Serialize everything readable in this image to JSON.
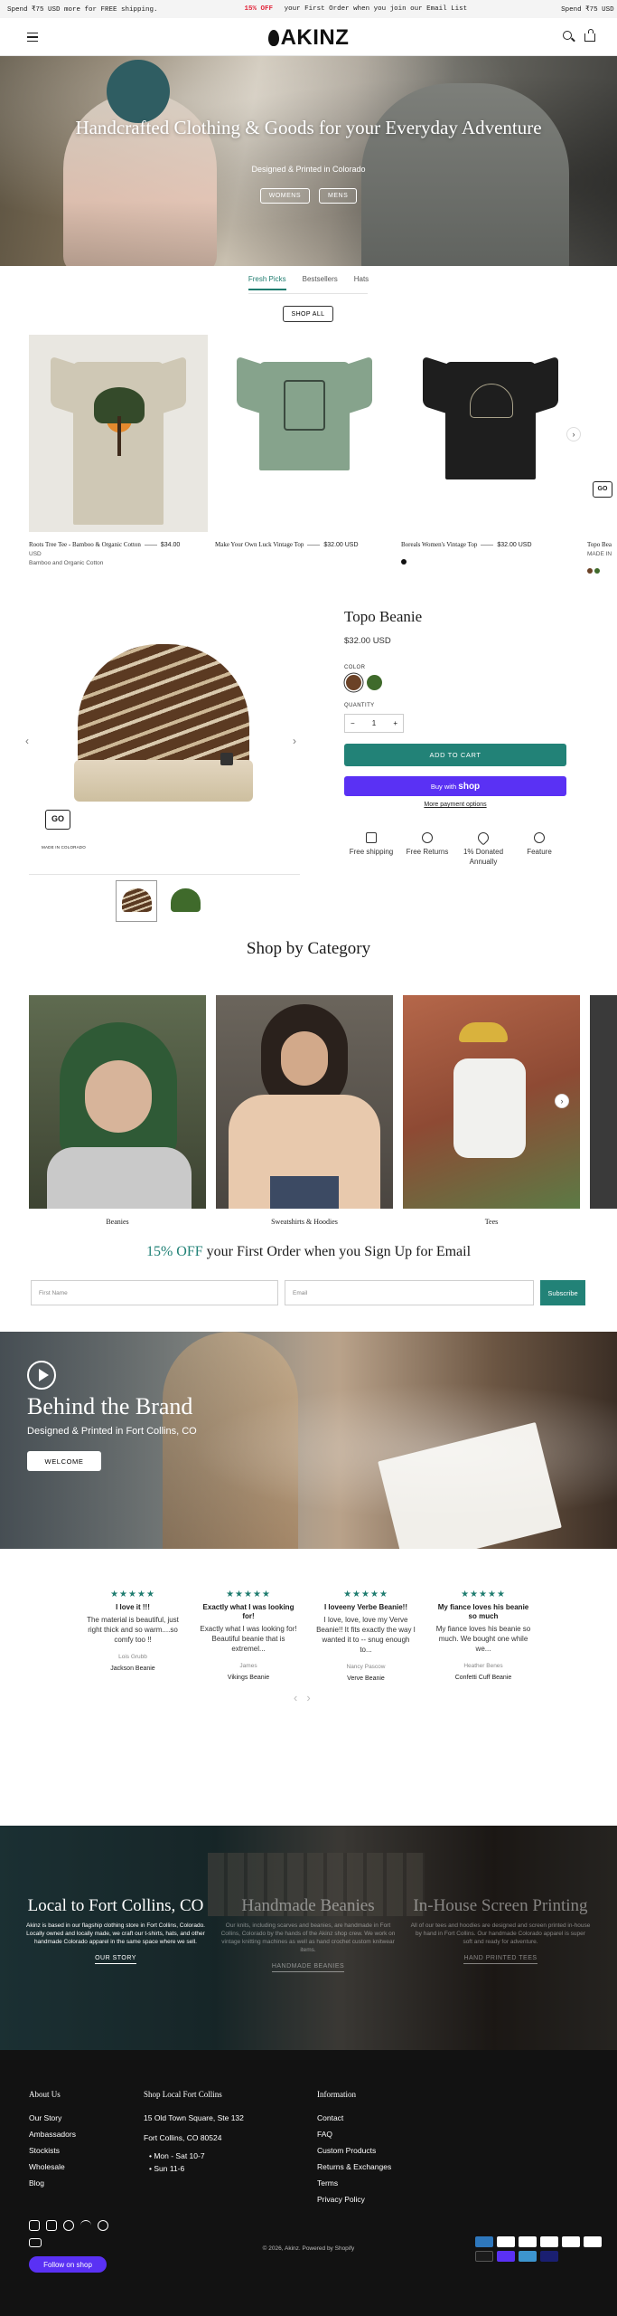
{
  "announcement": {
    "left": "Spend ₹75 USD more for FREE shipping.",
    "center_highlight": "15% OFF",
    "center_rest": " your First Order when you join our Email List",
    "right": "Spend ₹75 USD more for FREE sh"
  },
  "header": {
    "logo": "AKINZ"
  },
  "hero": {
    "title": "Handcrafted Clothing & Goods for your Everyday Adventure",
    "subtitle": "Designed & Printed in Colorado",
    "buttons": [
      "WOMENS",
      "MENS"
    ]
  },
  "tabs": [
    "Fresh Picks",
    "Bestsellers",
    "Hats"
  ],
  "shop_all": "SHOP ALL",
  "products": [
    {
      "name": "Roots Tree Tee - Bamboo & Organic Cotton",
      "price": "$34.00",
      "currency": "USD",
      "subtitle": "Bamboo and Organic Cotton",
      "color": "#cfc8b5"
    },
    {
      "name": "Make Your Own Luck Vintage Top",
      "price": "$32.00 USD",
      "color": "#86a38c"
    },
    {
      "name": "Boreals Women's Vintage Top",
      "price": "$32.00 USD",
      "color": "#1e1e1e"
    },
    {
      "name": "Topo Bea",
      "subtitle": "MADE IN"
    }
  ],
  "product_detail": {
    "title": "Topo Beanie",
    "price": "$32.00 USD",
    "color_label": "COLOR",
    "quantity_label": "QUANTITY",
    "quantity": "1",
    "add_to_cart": "ADD TO CART",
    "buy_with": "Buy with",
    "shop_word": "shop",
    "more_payment": "More payment options",
    "badge": "GO",
    "badge_text": "MADE IN COLORADO",
    "features": [
      {
        "label": "Free shipping",
        "icon": "box-icon"
      },
      {
        "label": "Free Returns",
        "icon": "return-icon"
      },
      {
        "label": "1% Donated Annually",
        "icon": "heart-icon"
      },
      {
        "label": "Feature",
        "icon": "star-icon"
      }
    ],
    "swatches": [
      "#6b4227",
      "#3f6a2b"
    ]
  },
  "categories": {
    "title": "Shop by Category",
    "items": [
      "Beanies",
      "Sweatshirts & Hoodies",
      "Tees"
    ]
  },
  "email": {
    "highlight": "15% OFF",
    "rest": " your First Order when you Sign Up for Email",
    "first_name_placeholder": "First Name",
    "email_placeholder": "Email",
    "subscribe": "Subscribe"
  },
  "brand": {
    "title": "Behind the Brand",
    "subtitle": "Designed & Printed in Fort Collins, CO",
    "button": "WELCOME"
  },
  "reviews": [
    {
      "stars": "★★★★★",
      "title": "I love it !!!",
      "body": "The material is beautiful, just right thick and so warm....so comfy too !!",
      "name": "Lois Grubb",
      "product": "Jackson Beanie"
    },
    {
      "stars": "★★★★★",
      "title": "Exactly what I was looking for!",
      "body": "Exactly what I was looking for! Beautiful beanie that is extremel...",
      "name": "James",
      "product": "Vikings Beanie"
    },
    {
      "stars": "★★★★★",
      "title": "I loveeny Verbe Beanie!!",
      "body": "I love, love, love my Verve Beanie!! It fits exactly the way I wanted it to -- snug enough to...",
      "name": "Nancy Pascow",
      "product": "Verve Beanie"
    },
    {
      "stars": "★★★★★",
      "title": "My fiance loves his beanie so much",
      "body": "My fiance loves his beanie so much. We bought one while we...",
      "name": "Heather Benes",
      "product": "Confetti Cuff Beanie"
    }
  ],
  "local": [
    {
      "title": "Local to Fort Collins, CO",
      "body": "Akinz is based in our flagship clothing store in Fort Collins, Colorado. Locally owned and locally made, we craft our t-shirts, hats, and other handmade Colorado apparel in the same space where we sell.",
      "link": "OUR STORY"
    },
    {
      "title": "Handmade Beanies",
      "body": "Our knits, including scarves and beanies, are handmade in Fort Collins, Colorado by the hands of the Akinz shop crew. We work on vintage knitting machines as well as hand crochet custom knitwear items.",
      "link": "HANDMADE BEANIES"
    },
    {
      "title": "In-House Screen Printing",
      "body": "All of our tees and hoodies are designed and screen printed in-house by hand in Fort Collins. Our handmade Colorado apparel is super soft and ready for adventure.",
      "link": "HAND PRINTED TEES"
    }
  ],
  "footer": {
    "about_title": "About Us",
    "about": [
      "Our Story",
      "Ambassadors",
      "Stockists",
      "Wholesale",
      "Blog"
    ],
    "shop_title": "Shop Local Fort Collins",
    "address1": "15 Old Town Square, Ste 132",
    "address2": "Fort Collins, CO 80524",
    "hours": [
      "Mon - Sat 10-7",
      "Sun 11-6"
    ],
    "info_title": "Information",
    "info": [
      "Contact",
      "FAQ",
      "Custom Products",
      "Returns & Exchanges",
      "Terms",
      "Privacy Policy"
    ],
    "follow": "Follow on shop",
    "copyright": "© 2026, Akinz. Powered by Shopify"
  }
}
